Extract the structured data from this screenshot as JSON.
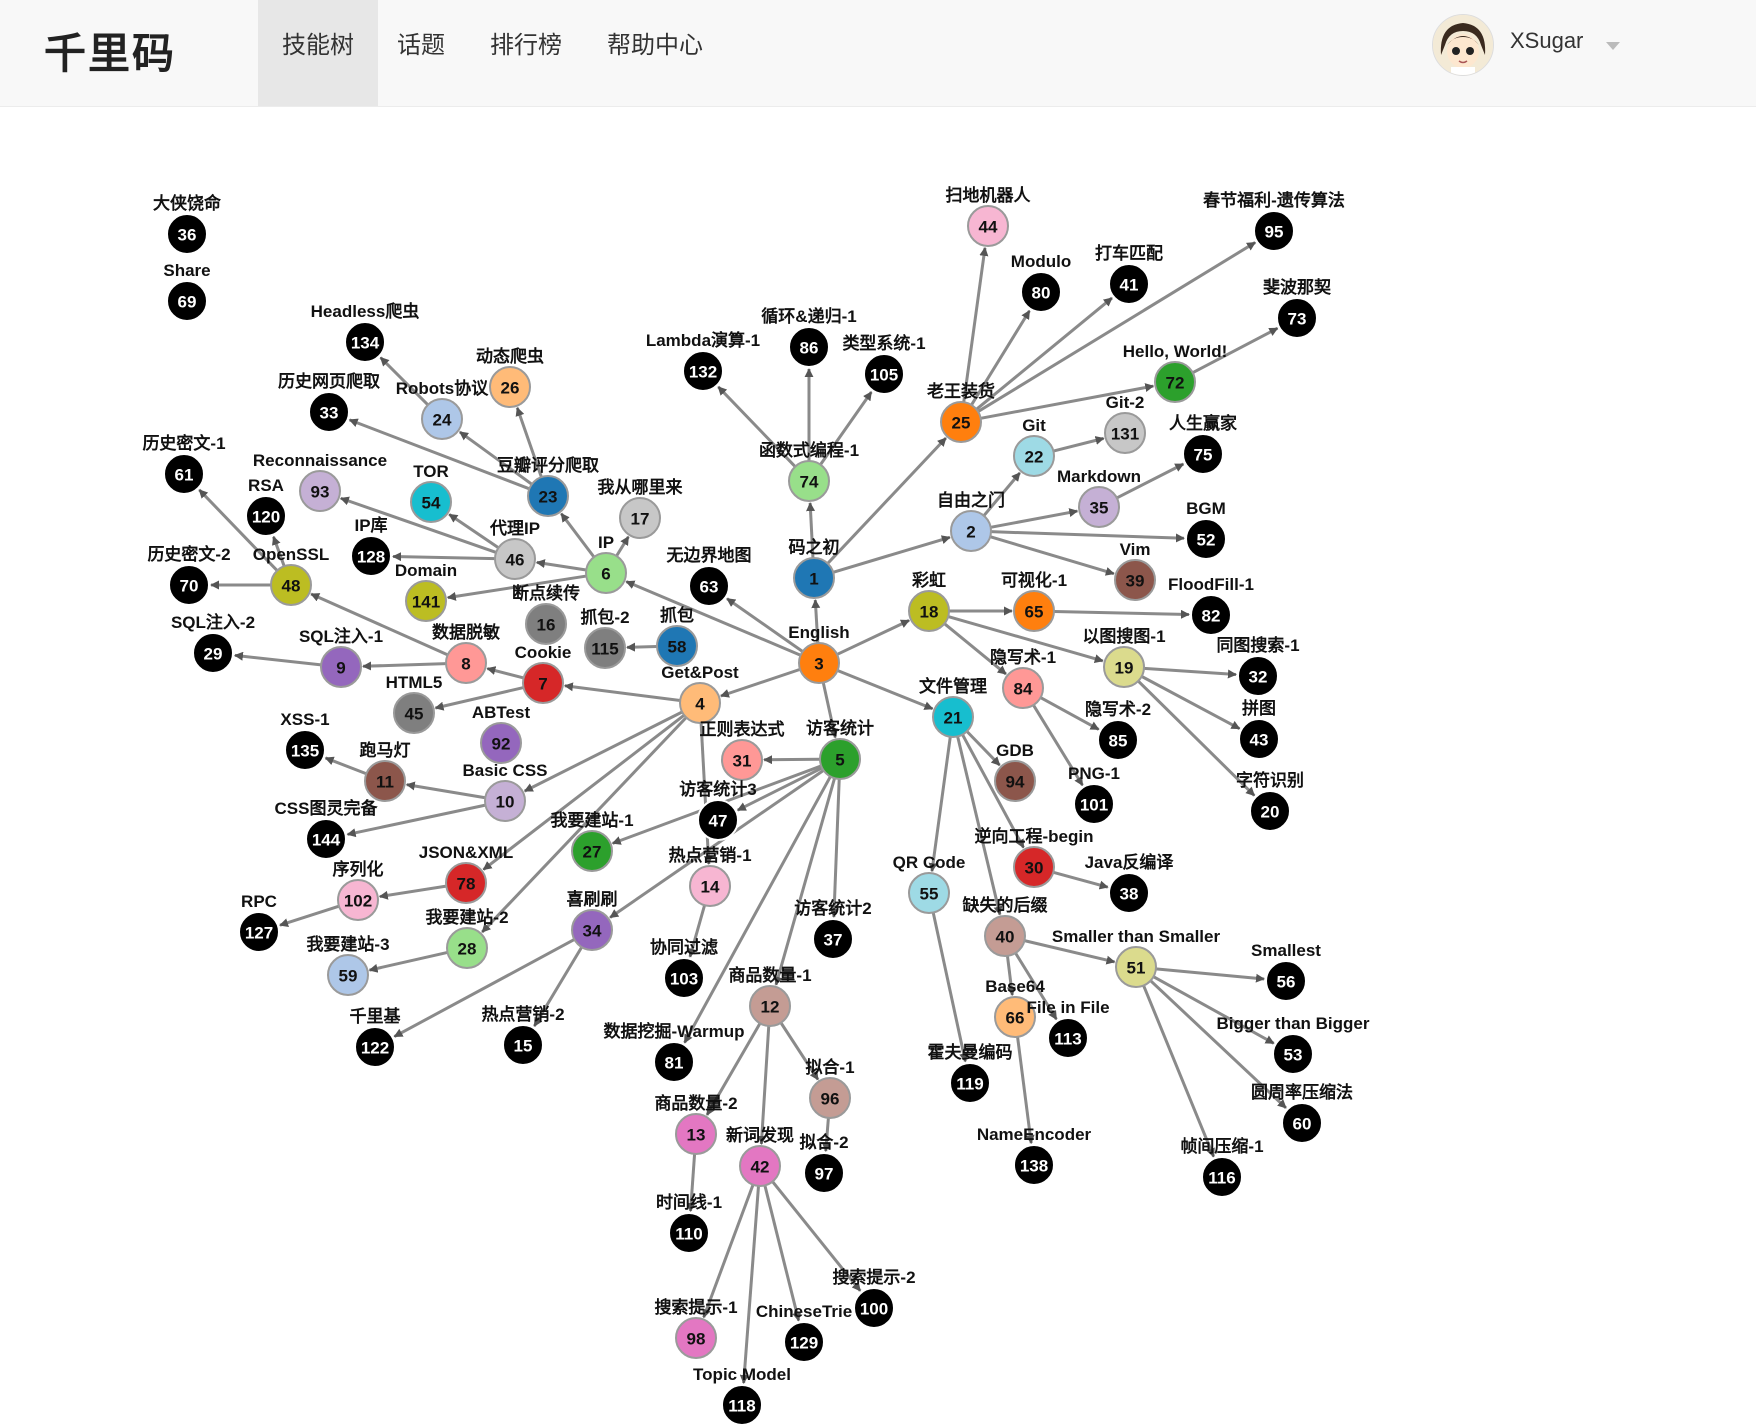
{
  "header": {
    "logo": "千里码",
    "nav": [
      "技能树",
      "话题",
      "排行榜",
      "帮助中心"
    ],
    "active_index": 0,
    "username": "XSugar"
  },
  "colors": {
    "c_blue": "#1f77b4",
    "c_lightblue": "#aec7e8",
    "c_orange": "#ff7f0e",
    "c_lightorange": "#ffbb78",
    "c_green": "#2ca02c",
    "c_lightgreen": "#98df8a",
    "c_red": "#d62728",
    "c_pink": "#ff9896",
    "c_purple": "#9467bd",
    "c_lavender": "#c5b0d5",
    "c_brown": "#8c564b",
    "c_rosebrown": "#c49c94",
    "c_magenta": "#e377c2",
    "c_lightpink": "#f7b6d2",
    "c_gray": "#7f7f7f",
    "c_lightgray": "#c7c7c7",
    "c_olive": "#bcbd22",
    "c_khaki": "#dbdb8d",
    "c_cyan": "#17becf",
    "c_lightcyan": "#9edae5",
    "c_black": "#000000",
    "edge": "#8a8a8a"
  },
  "graph": {
    "nodes": [
      {
        "id": "1",
        "label": "码之初",
        "color": "c_blue"
      },
      {
        "id": "2",
        "label": "自由之门",
        "color": "c_lightblue"
      },
      {
        "id": "3",
        "label": "English",
        "color": "c_orange"
      },
      {
        "id": "4",
        "label": "Get&Post",
        "color": "c_lightorange"
      },
      {
        "id": "5",
        "label": "访客统计",
        "color": "c_green"
      },
      {
        "id": "6",
        "label": "IP",
        "color": "c_lightgreen"
      },
      {
        "id": "7",
        "label": "Cookie",
        "color": "c_red"
      },
      {
        "id": "8",
        "label": "数据脱敏",
        "color": "c_pink"
      },
      {
        "id": "9",
        "label": "SQL注入-1",
        "color": "c_purple"
      },
      {
        "id": "10",
        "label": "Basic CSS",
        "color": "c_lavender"
      },
      {
        "id": "11",
        "label": "跑马灯",
        "color": "c_brown"
      },
      {
        "id": "12",
        "label": "商品数量-1",
        "color": "c_rosebrown"
      },
      {
        "id": "13",
        "label": "商品数量-2",
        "color": "c_magenta"
      },
      {
        "id": "14",
        "label": "热点营销-1",
        "color": "c_lightpink"
      },
      {
        "id": "15",
        "label": "热点营销-2",
        "color": "c_black"
      },
      {
        "id": "16",
        "label": "断点续传",
        "color": "c_gray"
      },
      {
        "id": "17",
        "label": "我从哪里来",
        "color": "c_lightgray"
      },
      {
        "id": "18",
        "label": "彩虹",
        "color": "c_olive"
      },
      {
        "id": "19",
        "label": "以图搜图-1",
        "color": "c_khaki"
      },
      {
        "id": "20",
        "label": "字符识别",
        "color": "c_black"
      },
      {
        "id": "21",
        "label": "文件管理",
        "color": "c_cyan"
      },
      {
        "id": "22",
        "label": "Git",
        "color": "c_lightcyan"
      },
      {
        "id": "23",
        "label": "豆瓣评分爬取",
        "color": "c_blue"
      },
      {
        "id": "24",
        "label": "Robots协议",
        "color": "c_lightblue"
      },
      {
        "id": "25",
        "label": "老王装货",
        "color": "c_orange"
      },
      {
        "id": "26",
        "label": "动态爬虫",
        "color": "c_lightorange"
      },
      {
        "id": "27",
        "label": "我要建站-1",
        "color": "c_green"
      },
      {
        "id": "28",
        "label": "我要建站-2",
        "color": "c_lightgreen"
      },
      {
        "id": "29",
        "label": "SQL注入-2",
        "color": "c_black"
      },
      {
        "id": "30",
        "label": "逆向工程-begin",
        "color": "c_red"
      },
      {
        "id": "31",
        "label": "正则表达式",
        "color": "c_pink"
      },
      {
        "id": "32",
        "label": "同图搜索-1",
        "color": "c_black"
      },
      {
        "id": "33",
        "label": "历史网页爬取",
        "color": "c_black"
      },
      {
        "id": "34",
        "label": "喜刷刷",
        "color": "c_purple"
      },
      {
        "id": "35",
        "label": "Markdown",
        "color": "c_lavender"
      },
      {
        "id": "36",
        "label": "大侠饶命",
        "color": "c_black"
      },
      {
        "id": "37",
        "label": "访客统计2",
        "color": "c_black"
      },
      {
        "id": "38",
        "label": "Java反编译",
        "color": "c_black"
      },
      {
        "id": "39",
        "label": "Vim",
        "color": "c_brown"
      },
      {
        "id": "40",
        "label": "缺失的后缀",
        "color": "c_rosebrown"
      },
      {
        "id": "41",
        "label": "打车匹配",
        "color": "c_black"
      },
      {
        "id": "42",
        "label": "新词发现",
        "color": "c_magenta"
      },
      {
        "id": "43",
        "label": "拼图",
        "color": "c_black"
      },
      {
        "id": "44",
        "label": "扫地机器人",
        "color": "c_lightpink"
      },
      {
        "id": "45",
        "label": "HTML5",
        "color": "c_gray"
      },
      {
        "id": "46",
        "label": "代理IP",
        "color": "c_lightgray"
      },
      {
        "id": "47",
        "label": "访客统计3",
        "color": "c_black"
      },
      {
        "id": "48",
        "label": "OpenSSL",
        "color": "c_olive"
      },
      {
        "id": "51",
        "label": "Smaller than Smaller",
        "color": "c_khaki"
      },
      {
        "id": "52",
        "label": "BGM",
        "color": "c_black"
      },
      {
        "id": "53",
        "label": "Bigger than Bigger",
        "color": "c_black"
      },
      {
        "id": "54",
        "label": "TOR",
        "color": "c_cyan"
      },
      {
        "id": "55",
        "label": "QR Code",
        "color": "c_lightcyan"
      },
      {
        "id": "56",
        "label": "Smallest",
        "color": "c_black"
      },
      {
        "id": "58",
        "label": "抓包",
        "color": "c_blue"
      },
      {
        "id": "59",
        "label": "我要建站-3",
        "color": "c_lightblue"
      },
      {
        "id": "60",
        "label": "圆周率压缩法",
        "color": "c_black"
      },
      {
        "id": "61",
        "label": "历史密文-1",
        "color": "c_black"
      },
      {
        "id": "63",
        "label": "无边界地图",
        "color": "c_black"
      },
      {
        "id": "65",
        "label": "可视化-1",
        "color": "c_orange"
      },
      {
        "id": "66",
        "label": "Base64",
        "color": "c_lightorange"
      },
      {
        "id": "69",
        "label": "Share",
        "color": "c_black"
      },
      {
        "id": "70",
        "label": "历史密文-2",
        "color": "c_black"
      },
      {
        "id": "72",
        "label": "Hello, World!",
        "color": "c_green"
      },
      {
        "id": "73",
        "label": "斐波那契",
        "color": "c_black"
      },
      {
        "id": "74",
        "label": "函数式编程-1",
        "color": "c_lightgreen"
      },
      {
        "id": "75",
        "label": "人生赢家",
        "color": "c_black"
      },
      {
        "id": "78",
        "label": "JSON&XML",
        "color": "c_red"
      },
      {
        "id": "80",
        "label": "Modulo",
        "color": "c_black"
      },
      {
        "id": "81",
        "label": "数据挖掘-Warmup",
        "color": "c_black"
      },
      {
        "id": "82",
        "label": "FloodFill-1",
        "color": "c_black"
      },
      {
        "id": "84",
        "label": "隐写术-1",
        "color": "c_pink"
      },
      {
        "id": "85",
        "label": "隐写术-2",
        "color": "c_black"
      },
      {
        "id": "86",
        "label": "循环&递归-1",
        "color": "c_black"
      },
      {
        "id": "92",
        "label": "ABTest",
        "color": "c_purple"
      },
      {
        "id": "93",
        "label": "Reconnaissance",
        "color": "c_lavender"
      },
      {
        "id": "94",
        "label": "GDB",
        "color": "c_brown"
      },
      {
        "id": "95",
        "label": "春节福利-遗传算法",
        "color": "c_black"
      },
      {
        "id": "96",
        "label": "拟合-1",
        "color": "c_rosebrown"
      },
      {
        "id": "97",
        "label": "拟合-2",
        "color": "c_black"
      },
      {
        "id": "98",
        "label": "搜索提示-1",
        "color": "c_magenta"
      },
      {
        "id": "100",
        "label": "搜索提示-2",
        "color": "c_black"
      },
      {
        "id": "101",
        "label": "PNG-1",
        "color": "c_black"
      },
      {
        "id": "102",
        "label": "序列化",
        "color": "c_lightpink"
      },
      {
        "id": "103",
        "label": "协同过滤",
        "color": "c_black"
      },
      {
        "id": "105",
        "label": "类型系统-1",
        "color": "c_black"
      },
      {
        "id": "110",
        "label": "时间线-1",
        "color": "c_black"
      },
      {
        "id": "113",
        "label": "File in File",
        "color": "c_black"
      },
      {
        "id": "115",
        "label": "抓包-2",
        "color": "c_gray"
      },
      {
        "id": "116",
        "label": "帧间压缩-1",
        "color": "c_black"
      },
      {
        "id": "118",
        "label": "Topic Model",
        "color": "c_black"
      },
      {
        "id": "119",
        "label": "霍夫曼编码",
        "color": "c_black"
      },
      {
        "id": "120",
        "label": "RSA",
        "color": "c_black"
      },
      {
        "id": "122",
        "label": "千里基",
        "color": "c_black"
      },
      {
        "id": "127",
        "label": "RPC",
        "color": "c_black"
      },
      {
        "id": "128",
        "label": "IP库",
        "color": "c_black"
      },
      {
        "id": "129",
        "label": "ChineseTrie",
        "color": "c_black"
      },
      {
        "id": "131",
        "label": "Git-2",
        "color": "c_lightgray"
      },
      {
        "id": "132",
        "label": "Lambda演算-1",
        "color": "c_black"
      },
      {
        "id": "134",
        "label": "Headless爬虫",
        "color": "c_black"
      },
      {
        "id": "135",
        "label": "XSS-1",
        "color": "c_black"
      },
      {
        "id": "138",
        "label": "NameEncoder",
        "color": "c_black"
      },
      {
        "id": "141",
        "label": "Domain",
        "color": "c_olive"
      },
      {
        "id": "144",
        "label": "CSS图灵完备",
        "color": "c_black"
      }
    ],
    "edges": [
      [
        "3",
        "1"
      ],
      [
        "1",
        "74"
      ],
      [
        "1",
        "25"
      ],
      [
        "1",
        "2"
      ],
      [
        "74",
        "132"
      ],
      [
        "74",
        "86"
      ],
      [
        "74",
        "105"
      ],
      [
        "25",
        "44"
      ],
      [
        "25",
        "80"
      ],
      [
        "25",
        "41"
      ],
      [
        "25",
        "95"
      ],
      [
        "25",
        "72"
      ],
      [
        "72",
        "73"
      ],
      [
        "2",
        "22"
      ],
      [
        "22",
        "131"
      ],
      [
        "2",
        "35"
      ],
      [
        "35",
        "75"
      ],
      [
        "2",
        "52"
      ],
      [
        "2",
        "39"
      ],
      [
        "3",
        "63"
      ],
      [
        "3",
        "6"
      ],
      [
        "3",
        "4"
      ],
      [
        "3",
        "18"
      ],
      [
        "3",
        "21"
      ],
      [
        "3",
        "5"
      ],
      [
        "6",
        "17"
      ],
      [
        "6",
        "23"
      ],
      [
        "6",
        "46"
      ],
      [
        "6",
        "141"
      ],
      [
        "23",
        "24"
      ],
      [
        "23",
        "26"
      ],
      [
        "23",
        "33"
      ],
      [
        "24",
        "134"
      ],
      [
        "46",
        "54"
      ],
      [
        "46",
        "93"
      ],
      [
        "46",
        "128"
      ],
      [
        "58",
        "115"
      ],
      [
        "4",
        "7"
      ],
      [
        "4",
        "10"
      ],
      [
        "4",
        "78"
      ],
      [
        "4",
        "28"
      ],
      [
        "4",
        "14"
      ],
      [
        "7",
        "8"
      ],
      [
        "7",
        "45"
      ],
      [
        "8",
        "48"
      ],
      [
        "8",
        "9"
      ],
      [
        "9",
        "29"
      ],
      [
        "48",
        "61"
      ],
      [
        "48",
        "120"
      ],
      [
        "48",
        "70"
      ],
      [
        "10",
        "11"
      ],
      [
        "10",
        "144"
      ],
      [
        "11",
        "135"
      ],
      [
        "78",
        "102"
      ],
      [
        "102",
        "127"
      ],
      [
        "28",
        "59"
      ],
      [
        "14",
        "103"
      ],
      [
        "18",
        "65"
      ],
      [
        "18",
        "84"
      ],
      [
        "18",
        "19"
      ],
      [
        "65",
        "82"
      ],
      [
        "19",
        "32"
      ],
      [
        "19",
        "43"
      ],
      [
        "19",
        "20"
      ],
      [
        "84",
        "85"
      ],
      [
        "84",
        "101"
      ],
      [
        "21",
        "94"
      ],
      [
        "21",
        "30"
      ],
      [
        "21",
        "55"
      ],
      [
        "21",
        "40"
      ],
      [
        "30",
        "38"
      ],
      [
        "40",
        "51"
      ],
      [
        "40",
        "113"
      ],
      [
        "40",
        "66"
      ],
      [
        "51",
        "56"
      ],
      [
        "51",
        "53"
      ],
      [
        "51",
        "60"
      ],
      [
        "51",
        "116"
      ],
      [
        "55",
        "119"
      ],
      [
        "66",
        "138"
      ],
      [
        "5",
        "31"
      ],
      [
        "5",
        "47"
      ],
      [
        "5",
        "27"
      ],
      [
        "5",
        "37"
      ],
      [
        "5",
        "12"
      ],
      [
        "5",
        "81"
      ],
      [
        "5",
        "34"
      ],
      [
        "34",
        "122"
      ],
      [
        "34",
        "15"
      ],
      [
        "12",
        "96"
      ],
      [
        "12",
        "13"
      ],
      [
        "12",
        "42"
      ],
      [
        "96",
        "97"
      ],
      [
        "13",
        "110"
      ],
      [
        "42",
        "98"
      ],
      [
        "42",
        "129"
      ],
      [
        "42",
        "100"
      ],
      [
        "42",
        "118"
      ]
    ]
  }
}
